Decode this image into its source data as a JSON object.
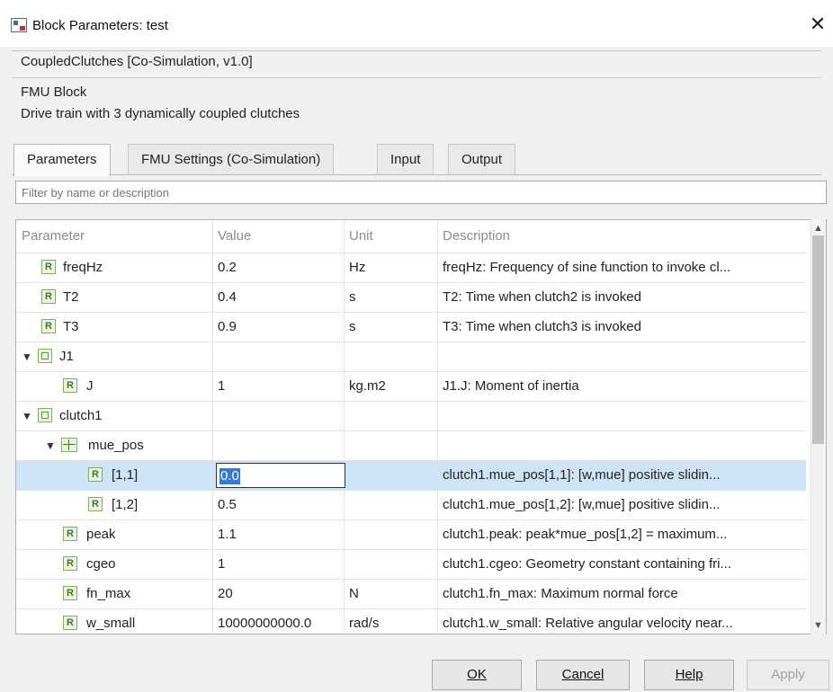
{
  "window": {
    "title": "Block Parameters: test",
    "close_label": "✕"
  },
  "header": {
    "block_name": "CoupledClutches [Co-Simulation, v1.0]",
    "block_type": "FMU Block",
    "block_description": "Drive train with 3 dynamically coupled clutches"
  },
  "tabs": [
    {
      "label": "Parameters",
      "active": true
    },
    {
      "label": "FMU Settings (Co-Simulation)",
      "active": false
    },
    {
      "label": "Input",
      "active": false
    },
    {
      "label": "Output",
      "active": false
    }
  ],
  "filter": {
    "placeholder": "Filter by name or description"
  },
  "table": {
    "headers": {
      "parameter": "Parameter",
      "value": "Value",
      "unit": "Unit",
      "description": "Description"
    },
    "rows": [
      {
        "name": "freqHz",
        "value": "0.2",
        "unit": "Hz",
        "description": "freqHz: Frequency of sine function to invoke cl..."
      },
      {
        "name": "T2",
        "value": "0.4",
        "unit": "s",
        "description": "T2: Time when clutch2 is invoked"
      },
      {
        "name": "T3",
        "value": "0.9",
        "unit": "s",
        "description": "T3: Time when clutch3 is invoked"
      },
      {
        "name": "J1",
        "value": "",
        "unit": "",
        "description": ""
      },
      {
        "name": "J",
        "value": "1",
        "unit": "kg.m2",
        "description": "J1.J: Moment of inertia"
      },
      {
        "name": "clutch1",
        "value": "",
        "unit": "",
        "description": ""
      },
      {
        "name": "mue_pos",
        "value": "",
        "unit": "",
        "description": ""
      },
      {
        "name": "[1,1]",
        "value": "0.0",
        "unit": "",
        "description": "clutch1.mue_pos[1,1]: [w,mue] positive slidin..."
      },
      {
        "name": "[1,2]",
        "value": "0.5",
        "unit": "",
        "description": "clutch1.mue_pos[1,2]: [w,mue] positive slidin..."
      },
      {
        "name": "peak",
        "value": "1.1",
        "unit": "",
        "description": "clutch1.peak: peak*mue_pos[1,2] = maximum..."
      },
      {
        "name": "cgeo",
        "value": "1",
        "unit": "",
        "description": "clutch1.cgeo: Geometry constant containing fri..."
      },
      {
        "name": "fn_max",
        "value": "20",
        "unit": "N",
        "description": "clutch1.fn_max: Maximum normal force"
      },
      {
        "name": "w_small",
        "value": "10000000000.0",
        "unit": "rad/s",
        "description": "clutch1.w_small: Relative angular velocity near..."
      }
    ],
    "badge_letter": "R"
  },
  "scrollbar": {
    "up_arrow": "▲",
    "down_arrow": "▼"
  },
  "buttons": {
    "ok": "OK",
    "cancel": "Cancel",
    "help": "Help",
    "apply": "Apply"
  }
}
